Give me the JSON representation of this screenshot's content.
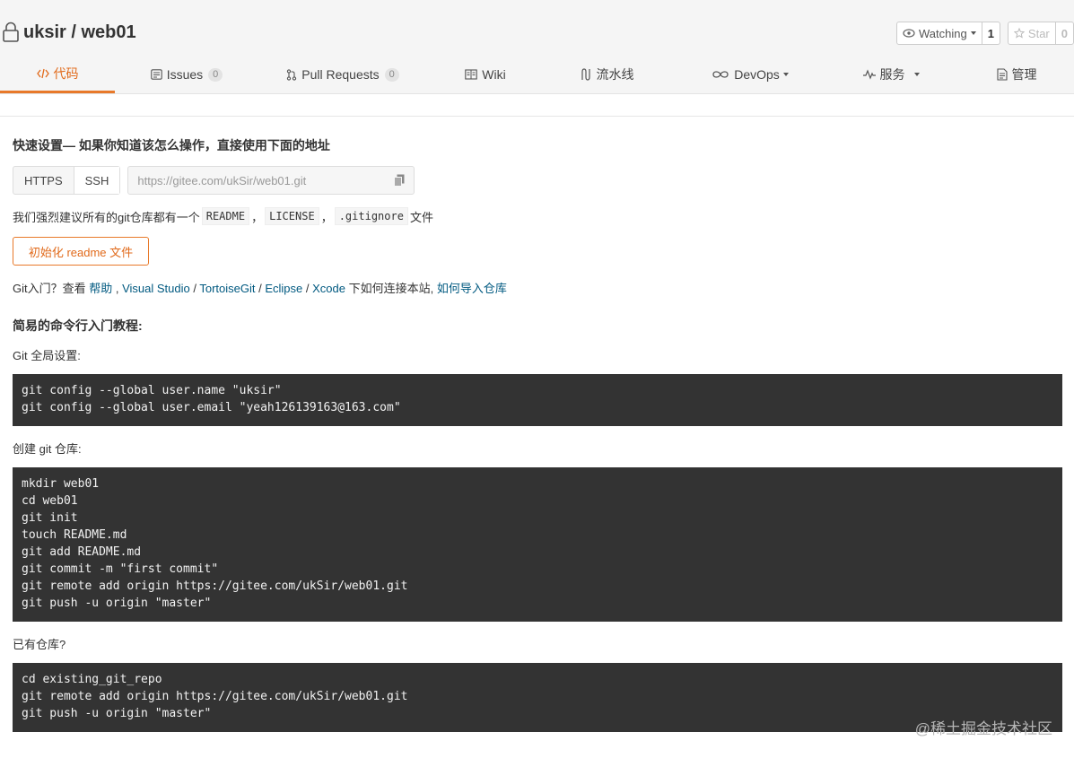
{
  "repo": {
    "owner_name": "uksir / web01"
  },
  "actions": {
    "watch_label": "Watching",
    "watch_count": "1",
    "star_label": "Star",
    "star_count": "0"
  },
  "tabs": [
    {
      "label": "代码"
    },
    {
      "label": "Issues",
      "badge": "0"
    },
    {
      "label": "Pull Requests",
      "badge": "0"
    },
    {
      "label": "Wiki"
    },
    {
      "label": "流水线"
    },
    {
      "label": "DevOps"
    },
    {
      "label": "服务"
    },
    {
      "label": "管理"
    }
  ],
  "quick_setup": {
    "title": "快速设置— 如果你知道该怎么操作，直接使用下面的地址",
    "https_label": "HTTPS",
    "ssh_label": "SSH",
    "url": "https://gitee.com/ukSir/web01.git",
    "recommend_prefix": "我们强烈建议所有的git仓库都有一个",
    "file_readme": "README",
    "sep1": "，",
    "file_license": "LICENSE",
    "sep2": "，",
    "file_gitignore": ".gitignore",
    "recommend_suffix": "文件",
    "init_button": "初始化 readme 文件",
    "help_prefix": "Git入门？查看 ",
    "help_link": "帮助",
    "help_sep1": " , ",
    "link_vs": "Visual Studio",
    "help_sep2": " / ",
    "link_tortoise": "TortoiseGit",
    "help_sep3": " / ",
    "link_eclipse": "Eclipse",
    "help_sep4": " / ",
    "link_xcode": "Xcode",
    "help_mid": " 下如何连接本站, ",
    "link_import": "如何导入仓库"
  },
  "tutorial": {
    "title": "简易的命令行入门教程:",
    "global_label": "Git 全局设置:",
    "global_code": "git config --global user.name \"uksir\"\ngit config --global user.email \"yeah126139163@163.com\"",
    "create_label": "创建 git 仓库:",
    "create_code": "mkdir web01\ncd web01\ngit init\ntouch README.md\ngit add README.md\ngit commit -m \"first commit\"\ngit remote add origin https://gitee.com/ukSir/web01.git\ngit push -u origin \"master\"",
    "existing_label": "已有仓库?",
    "existing_code": "cd existing_git_repo\ngit remote add origin https://gitee.com/ukSir/web01.git\ngit push -u origin \"master\""
  },
  "watermark": "@稀土掘金技术社区",
  "colors": {
    "accent": "#e8792a",
    "link": "#005980",
    "code_bg": "#333333"
  }
}
